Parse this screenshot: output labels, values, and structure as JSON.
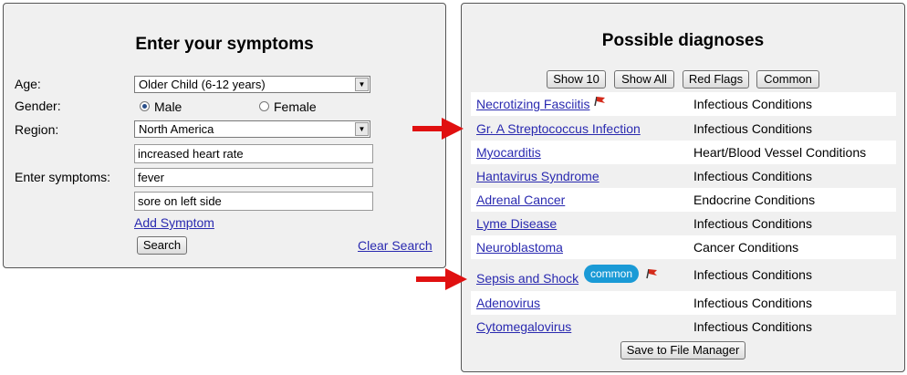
{
  "symptom_form": {
    "title": "Enter your symptoms",
    "age_label": "Age:",
    "age_value": "Older Child (6-12 years)",
    "gender_label": "Gender:",
    "gender_options": [
      "Male",
      "Female"
    ],
    "gender_selected": "Male",
    "region_label": "Region:",
    "region_value": "North America",
    "symptoms_label": "Enter symptoms:",
    "symptoms": [
      "increased heart rate",
      "fever",
      "sore on left side"
    ],
    "add_symptom": "Add Symptom",
    "search_button": "Search",
    "clear_search": "Clear Search"
  },
  "diagnoses": {
    "title": "Possible diagnoses",
    "filters": [
      "Show 10",
      "Show All",
      "Red Flags",
      "Common"
    ],
    "items": [
      {
        "name": "Necrotizing Fasciitis",
        "category": "Infectious Conditions",
        "red_flag": true
      },
      {
        "name": "Gr. A Streptococcus Infection",
        "category": "Infectious Conditions"
      },
      {
        "name": "Myocarditis",
        "category": "Heart/Blood Vessel Conditions"
      },
      {
        "name": "Hantavirus Syndrome",
        "category": "Infectious Conditions"
      },
      {
        "name": "Adrenal Cancer",
        "category": "Endocrine Conditions"
      },
      {
        "name": "Lyme Disease",
        "category": "Infectious Conditions"
      },
      {
        "name": "Neuroblastoma",
        "category": "Cancer Conditions"
      },
      {
        "name": "Sepsis and Shock",
        "category": "Infectious Conditions",
        "badge": "common",
        "red_flag": true
      },
      {
        "name": "Adenovirus",
        "category": "Infectious Conditions"
      },
      {
        "name": "Cytomegalovirus",
        "category": "Infectious Conditions"
      }
    ],
    "save_button": "Save to File Manager"
  },
  "colors": {
    "link": "#2a2ab0",
    "badge": "#1a9ad6",
    "arrow": "#e01010",
    "flag": "#d42a1a"
  }
}
